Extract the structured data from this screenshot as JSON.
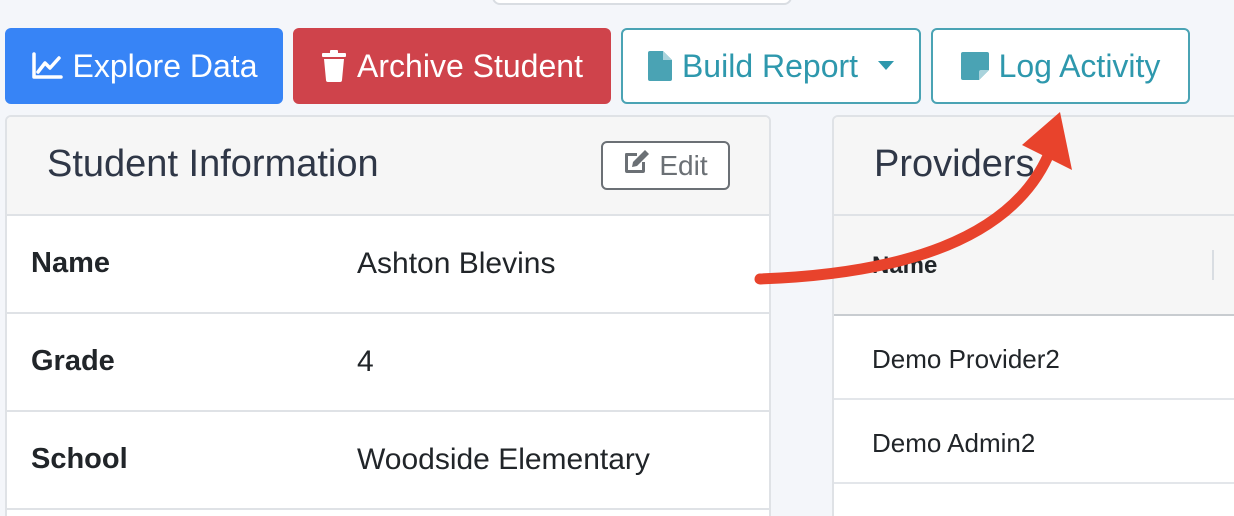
{
  "toolbar": {
    "explore_label": "Explore Data",
    "archive_label": "Archive Student",
    "report_label": "Build Report",
    "log_label": "Log Activity"
  },
  "student_info": {
    "title": "Student Information",
    "edit_label": "Edit",
    "rows": [
      {
        "label": "Name",
        "value": "Ashton Blevins"
      },
      {
        "label": "Grade",
        "value": "4"
      },
      {
        "label": "School",
        "value": "Woodside Elementary"
      }
    ]
  },
  "providers": {
    "title": "Providers",
    "column_header": "Name",
    "rows": [
      "Demo Provider2",
      "Demo Admin2"
    ]
  },
  "icons": {
    "explore": "chart-line-icon",
    "archive": "trash-icon",
    "report": "file-icon",
    "log": "sticky-note-icon",
    "edit": "edit-icon",
    "dropdown": "caret-down-icon"
  },
  "colors": {
    "primary": "#3784f6",
    "danger": "#cf434b",
    "info_outline": "#2e98ad",
    "annotation_arrow": "#e8432c"
  }
}
